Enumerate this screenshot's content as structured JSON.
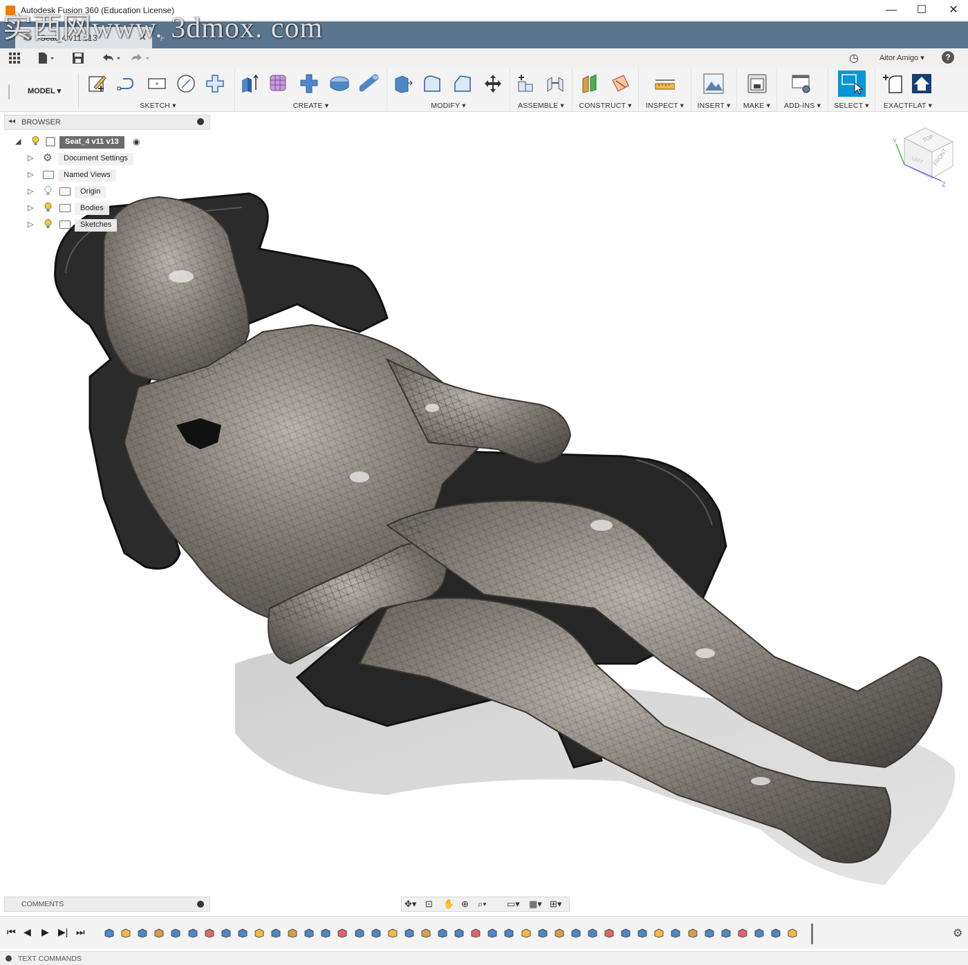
{
  "window": {
    "title": "Autodesk Fusion 360 (Education License)",
    "controls": {
      "minimize": "—",
      "maximize": "☐",
      "close": "✕"
    }
  },
  "watermark": "实西网www. 3dmox. com",
  "tabs": [
    {
      "label": "Seat_4 v11 v13*",
      "active": true
    }
  ],
  "quick_access": {
    "user": "Aitor Amigo ▾",
    "help": "?"
  },
  "ribbon": {
    "workspace": "MODEL ▾",
    "groups": [
      {
        "label": "SKETCH ▾"
      },
      {
        "label": "CREATE ▾"
      },
      {
        "label": "MODIFY ▾"
      },
      {
        "label": "ASSEMBLE ▾"
      },
      {
        "label": "CONSTRUCT ▾"
      },
      {
        "label": "INSPECT ▾"
      },
      {
        "label": "INSERT ▾"
      },
      {
        "label": "MAKE ▾"
      },
      {
        "label": "ADD-INS ▾"
      },
      {
        "label": "SELECT ▾"
      },
      {
        "label": "EXACTFLAT ▾"
      }
    ]
  },
  "browser": {
    "title": "BROWSER",
    "root": "Seat_4 v11 v13",
    "items": [
      {
        "label": "Document Settings",
        "icon": "gear-icon"
      },
      {
        "label": "Named Views",
        "icon": "folder-icon"
      },
      {
        "label": "Origin",
        "icon": "folder-icon",
        "visible": false
      },
      {
        "label": "Bodies",
        "icon": "folder-icon",
        "visible": true
      },
      {
        "label": "Sketches",
        "icon": "folder-icon",
        "visible": true
      }
    ]
  },
  "viewcube": {
    "top": "TOP",
    "front": "FRONT",
    "left": "LEFT",
    "axes": [
      "Y",
      "Z"
    ]
  },
  "comments": {
    "title": "COMMENTS"
  },
  "text_commands": {
    "title": "TEXT COMMANDS"
  },
  "colors": {
    "tab_strip": "#5a7590",
    "accent_select": "#0696d7",
    "model_body": "#7d7770",
    "seat": "#2b2b2b"
  }
}
